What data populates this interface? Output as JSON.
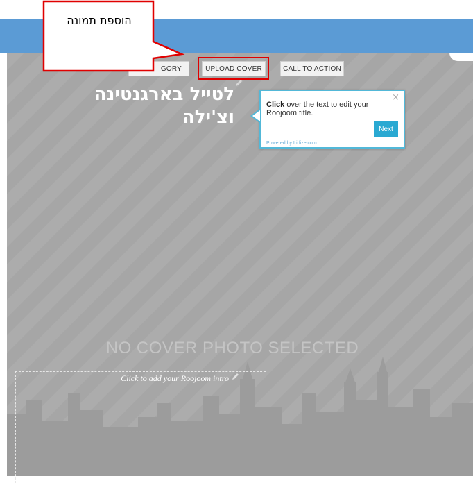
{
  "toolbar": {
    "category_label": "GORY",
    "upload_cover_label": "UPLOAD COVER",
    "call_to_action_label": "CALL TO ACTION"
  },
  "title": {
    "text": "לטייל בארגנטינה וצ'ילה"
  },
  "callout": {
    "text": "הוספת תמונה"
  },
  "tooltip": {
    "bold": "Click",
    "text": " over the text to edit your Roojoom title.",
    "close": "×",
    "next_label": "Next",
    "powered_by": "Powered by Iridize.com"
  },
  "cover": {
    "placeholder": "NO COVER PHOTO SELECTED",
    "intro_text": "Click to add your Roojoom intro"
  },
  "colors": {
    "topbar": "#5b9bd5",
    "highlight": "#e00000",
    "tooltip_border": "#52b8d8",
    "next_button": "#2aa9d2",
    "stage": "#a6a6a6"
  },
  "icons": [
    "pencil-icon",
    "close-icon",
    "skyline-image"
  ]
}
